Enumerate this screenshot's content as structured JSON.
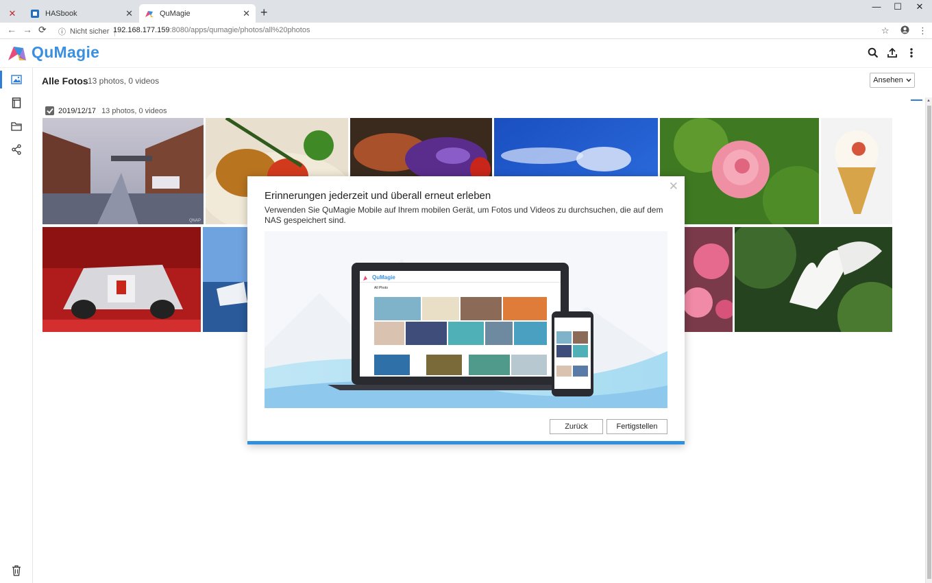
{
  "browser": {
    "tabs": [
      {
        "label": "",
        "favicon": "x-logo-icon"
      },
      {
        "label": "HASbook",
        "favicon": "hasbook-icon"
      },
      {
        "label": "QuMagie",
        "favicon": "qumagie-icon"
      }
    ],
    "new_tab": "+",
    "security_label": "Nicht sicher",
    "url_host": "192.168.177.159",
    "url_rest": ":8080/apps/qumagie/photos/all%20photos"
  },
  "app": {
    "logo_text": "QuMagie",
    "brand_color": "#3a8fe0",
    "accent_color": "#2f7dd8"
  },
  "sidebar": {
    "items": [
      {
        "name": "photos",
        "icon": "image-icon",
        "active": true
      },
      {
        "name": "albums",
        "icon": "album-icon",
        "active": false
      },
      {
        "name": "folders",
        "icon": "folder-icon",
        "active": false
      },
      {
        "name": "shared",
        "icon": "share-icon",
        "active": false
      },
      {
        "name": "trash",
        "icon": "trash-icon",
        "active": false
      }
    ]
  },
  "content": {
    "title": "Alle Fotos",
    "count": "13 photos, 0 videos",
    "view_button": "Ansehen"
  },
  "group": {
    "checked": true,
    "date": "2019/12/17",
    "count": "13 photos, 0 videos"
  },
  "photos": [
    {
      "subject": "harbor-brick-warehouses"
    },
    {
      "subject": "food-plate-rosemary"
    },
    {
      "subject": "grilled-eggplant"
    },
    {
      "subject": "blue-sky-clouds"
    },
    {
      "subject": "pink-flower"
    },
    {
      "subject": "ice-cream-cone"
    },
    {
      "subject": "race-car-showroom"
    },
    {
      "subject": "harbor-boats"
    },
    {
      "subject": "pink-blossoms"
    },
    {
      "subject": "white-cyclamen"
    }
  ],
  "dialog": {
    "title": "Erinnerungen jederzeit und überall erneut erleben",
    "description": "Verwenden Sie QuMagie Mobile auf Ihrem mobilen Gerät, um Fotos und Videos zu durchsuchen, die auf dem NAS gespeichert sind.",
    "back_button": "Zurück",
    "finish_button": "Fertigstellen",
    "illustration": {
      "laptop_logo": "QuMagie",
      "laptop_heading": "All Photo"
    }
  }
}
